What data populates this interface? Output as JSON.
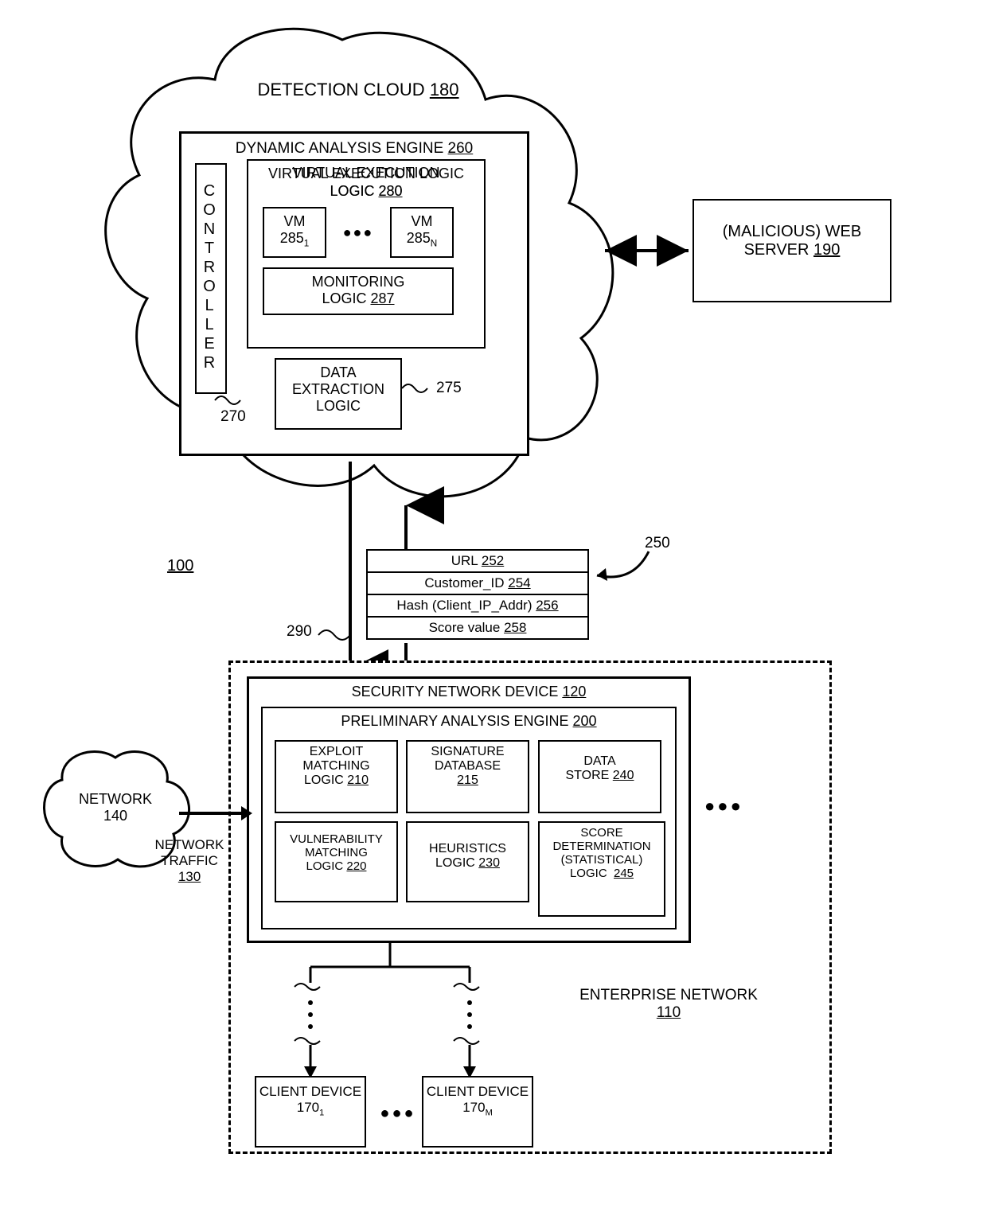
{
  "figure_ref": "100",
  "cloud": {
    "title": "DETECTION CLOUD ",
    "ref": "180",
    "engine_title": "DYNAMIC ANALYSIS ENGINE ",
    "engine_ref": "260",
    "controller": "CONTROLLER",
    "controller_ref": "270",
    "vel_title": "VIRTUAL EXECUTION LOGIC ",
    "vel_ref": "280",
    "vm_label": "VM",
    "vm_num": "285",
    "vm_sub1": "1",
    "vm_subN": "N",
    "ellipsis": "●●●",
    "mon_title": "MONITORING LOGIC ",
    "mon_ref": "287",
    "data_ext_title": "DATA EXTRACTION LOGIC",
    "data_ext_ref": "275"
  },
  "webserver": {
    "title1": "(MALICIOUS) WEB",
    "title2": "SERVER ",
    "ref": "190"
  },
  "packet": {
    "url": "URL ",
    "url_ref": "252",
    "cust": "Customer_ID ",
    "cust_ref": "254",
    "hash": "Hash (Client_IP_Addr) ",
    "hash_ref": "256",
    "score": "Score value ",
    "score_ref": "258",
    "side_ref": "250",
    "arrow_ref": "290"
  },
  "enterprise": {
    "title": "ENTERPRISE NETWORK",
    "ref": "110",
    "snd_title": "SECURITY NETWORK DEVICE ",
    "snd_ref": "120",
    "pae_title": "PRELIMINARY ANALYSIS ENGINE ",
    "pae_ref": "200",
    "exploit": "EXPLOIT MATCHING LOGIC ",
    "exploit_ref": "210",
    "sigdb": "SIGNATURE DATABASE",
    "sigdb_ref": "215",
    "datastore": "DATA STORE ",
    "datastore_ref": "240",
    "vuln": "VULNERABILITY MATCHING LOGIC ",
    "vuln_ref": "220",
    "heur": "HEURISTICS LOGIC ",
    "heur_ref": "230",
    "scorelogic1": "SCORE DETERMINATION (STATISTICAL) LOGIC ",
    "scorelogic_ref": "245",
    "ellipsis": "●●●"
  },
  "network": {
    "title": "NETWORK",
    "ref": "140",
    "traffic": "NETWORK TRAFFIC",
    "traffic_ref": "130"
  },
  "clients": {
    "title": "CLIENT DEVICE",
    "num": "170",
    "sub1": "1",
    "subM": "M",
    "ellipsis": "●●●"
  },
  "vellipsis": "⋮"
}
